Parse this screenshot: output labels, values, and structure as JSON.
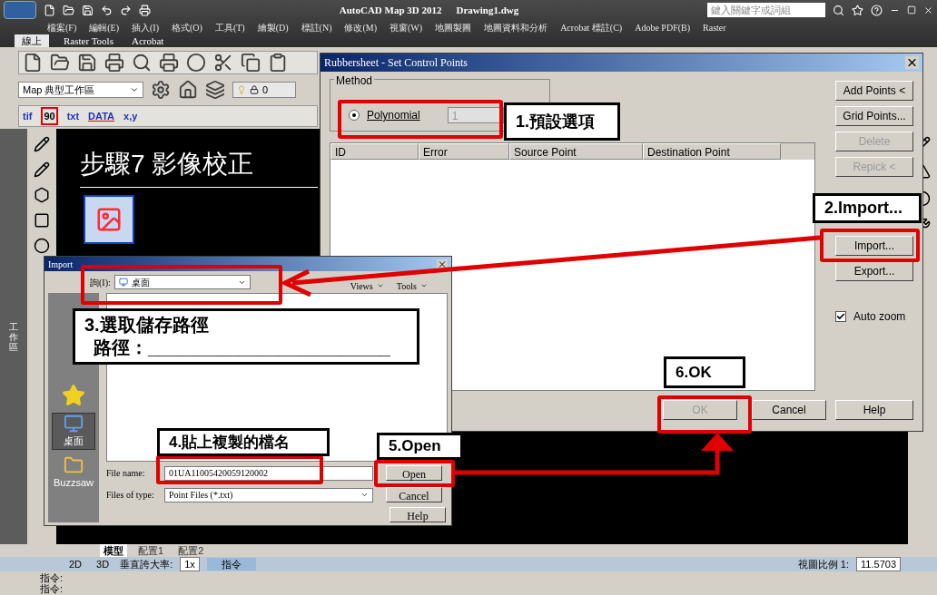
{
  "title_bar": {
    "title": "AutoCAD Map 3D 2012",
    "document": "Drawing1.dwg",
    "search": {
      "placeholder": "鍵入關鍵字或詞組"
    }
  },
  "menu": [
    "檔案(F)",
    "編輯(E)",
    "插入(I)",
    "格式(O)",
    "工具(T)",
    "繪製(D)",
    "標註(N)",
    "修改(M)",
    "視窗(W)",
    "地圖製圖",
    "地圖資料和分析",
    "Acrobat 標註(C)",
    "Adobe PDF(B)",
    "Raster"
  ],
  "ribbon_tabs": [
    {
      "label": "線上",
      "selected": true
    },
    {
      "label": "Raster Tools",
      "selected": false
    },
    {
      "label": "Acrobat",
      "selected": false
    }
  ],
  "workspace": {
    "value": "Map 典型工作區"
  },
  "layer": {
    "value": "0"
  },
  "icon_labels": [
    "tif",
    "90",
    "txt",
    "DATA",
    "x,y"
  ],
  "palette_label": "工作區",
  "canvas": {
    "heading": "步驟7 影像校正"
  },
  "layout_tabs": [
    {
      "label": "模型",
      "selected": true
    },
    {
      "label": "配置1",
      "selected": false
    },
    {
      "label": "配置2",
      "selected": false
    }
  ],
  "status_bar": {
    "items": [
      "2D",
      "3D"
    ],
    "exaggeration_label": "垂直誇大率:",
    "exaggeration": "1x",
    "command_tab": "指令",
    "scale_label": "視圖比例 1:",
    "scale": "11.5703"
  },
  "command_lines": [
    "指令:",
    "指令:"
  ],
  "rubbersheet": {
    "title": "Rubbersheet - Set Control Points",
    "method_label": "Method",
    "radios": [
      {
        "label": "Polynomial",
        "selected": true
      }
    ],
    "order": "1",
    "columns": [
      "ID",
      "Error",
      "Source Point",
      "Destination Point"
    ],
    "side_buttons": [
      {
        "label": "Add Points <",
        "disabled": false
      },
      {
        "label": "Grid Points...",
        "disabled": false
      },
      {
        "label": "Delete",
        "disabled": true
      },
      {
        "label": "Repick <",
        "disabled": true
      },
      {
        "label": "Import...",
        "disabled": false
      },
      {
        "label": "Export...",
        "disabled": false
      }
    ],
    "auto_zoom": {
      "label": "Auto zoom",
      "checked": true
    },
    "footer_buttons": [
      {
        "label": "OK",
        "disabled": true
      },
      {
        "label": "Cancel",
        "disabled": false
      },
      {
        "label": "Help",
        "disabled": false
      }
    ]
  },
  "import_dialog": {
    "title": "Import",
    "look_in_label": "詢(I):",
    "look_in": "桌面",
    "tools": [
      "Views",
      "Tools"
    ],
    "places": [
      {
        "label": "桌面",
        "selected": true
      },
      {
        "label": "Buzzsaw",
        "selected": false
      }
    ],
    "file_name_label": "File name:",
    "file_name": "01UA11005420059120002",
    "file_type_label": "Files of type:",
    "file_type": "Point Files (*.txt)",
    "buttons": [
      "Open",
      "Cancel",
      "Help"
    ]
  },
  "annotations": [
    {
      "lines": [
        "1.預設選項"
      ]
    },
    {
      "lines": [
        "2.Import..."
      ]
    },
    {
      "lines": [
        "3.選取儲存路徑",
        "路徑：________________________"
      ]
    },
    {
      "lines": [
        "4.貼上複製的檔名"
      ]
    },
    {
      "lines": [
        "5.Open"
      ]
    },
    {
      "lines": [
        "6.OK"
      ]
    }
  ]
}
